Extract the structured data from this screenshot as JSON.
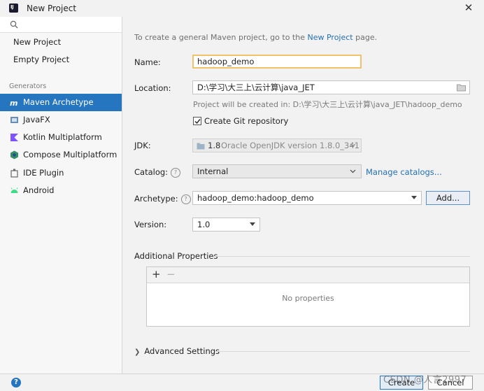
{
  "window": {
    "title": "New Project"
  },
  "sidebar": {
    "search_placeholder": "",
    "top_items": [
      {
        "label": "New Project"
      },
      {
        "label": "Empty Project"
      }
    ],
    "group_label": "Generators",
    "generators": [
      {
        "label": "Maven Archetype",
        "icon": "maven-icon",
        "active": true
      },
      {
        "label": "JavaFX",
        "icon": "javafx-icon"
      },
      {
        "label": "Kotlin Multiplatform",
        "icon": "kotlin-icon"
      },
      {
        "label": "Compose Multiplatform",
        "icon": "compose-icon"
      },
      {
        "label": "IDE Plugin",
        "icon": "plugin-icon"
      },
      {
        "label": "Android",
        "icon": "android-icon"
      }
    ]
  },
  "form": {
    "hint_prefix": "To create a general Maven project, go to the",
    "hint_link": "New Project",
    "hint_suffix": "page.",
    "name_label": "Name:",
    "name_value": "hadoop_demo",
    "location_label": "Location:",
    "location_value": "D:\\学习\\大三上\\云计算\\java_JET",
    "created_in": "Project will be created in: D:\\学习\\大三上\\云计算\\java_JET\\hadoop_demo",
    "git_label": "Create Git repository",
    "git_checked": true,
    "jdk_label": "JDK:",
    "jdk_version": "1.8",
    "jdk_detail": "Oracle OpenJDK version 1.8.0_341",
    "catalog_label": "Catalog:",
    "catalog_value": "Internal",
    "manage_catalogs": "Manage catalogs...",
    "archetype_label": "Archetype:",
    "archetype_value": "hadoop_demo:hadoop_demo",
    "add_button": "Add...",
    "version_label": "Version:",
    "version_value": "1.0",
    "additional_properties": "Additional Properties",
    "add_prop": "+",
    "remove_prop": "−",
    "no_properties": "No properties",
    "advanced_settings": "Advanced Settings"
  },
  "footer": {
    "help": "?",
    "create_button": "Create",
    "cancel_button": "Cancel",
    "watermark": "CSDN @人言2997"
  }
}
